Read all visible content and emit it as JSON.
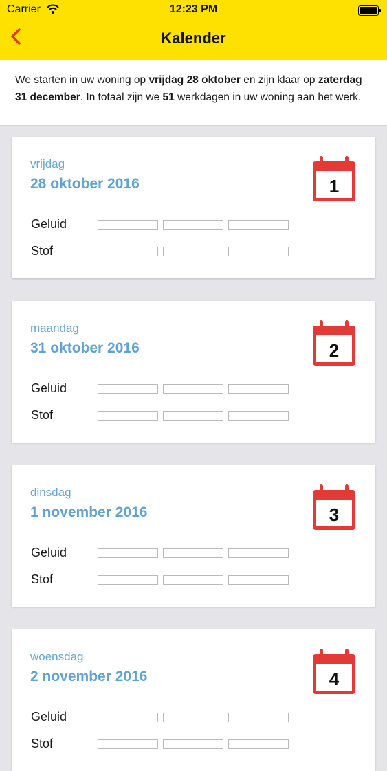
{
  "status_bar": {
    "carrier": "Carrier",
    "time": "12:23 PM",
    "wifi_icon": "wifi-icon",
    "battery_icon": "battery-icon"
  },
  "nav": {
    "title": "Kalender",
    "back_icon": "chevron-left-icon"
  },
  "intro": {
    "t1": "We starten in uw woning op ",
    "start_date": "vrijdag 28 oktober",
    "t2": " en zijn klaar op ",
    "end_date": "zaterdag 31 december",
    "t3": ". In totaal zijn we ",
    "workdays": "51",
    "t4": " werkdagen in uw woning aan het werk."
  },
  "colors": {
    "brand_yellow": "#ffe100",
    "date_blue": "#5ea3d4",
    "calendar_red": "#e53935"
  },
  "days": [
    {
      "weekday": "vrijdag",
      "date": "28 oktober 2016",
      "day_number": "1",
      "noise_label": "Geluid",
      "noise_level": 0,
      "dust_label": "Stof",
      "dust_level": 0
    },
    {
      "weekday": "maandag",
      "date": "31 oktober 2016",
      "day_number": "2",
      "noise_label": "Geluid",
      "noise_level": 0,
      "dust_label": "Stof",
      "dust_level": 0
    },
    {
      "weekday": "dinsdag",
      "date": "1 november 2016",
      "day_number": "3",
      "noise_label": "Geluid",
      "noise_level": 0,
      "dust_label": "Stof",
      "dust_level": 0
    },
    {
      "weekday": "woensdag",
      "date": "2 november 2016",
      "day_number": "4",
      "noise_label": "Geluid",
      "noise_level": 0,
      "dust_label": "Stof",
      "dust_level": 0
    }
  ]
}
